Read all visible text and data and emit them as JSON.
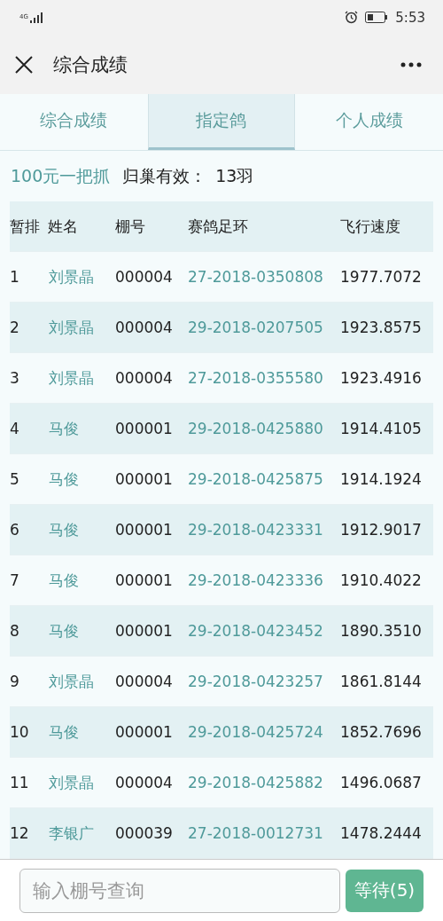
{
  "status_bar": {
    "network": "4G",
    "time": "5:53"
  },
  "header": {
    "title": "综合成绩"
  },
  "tabs": [
    {
      "label": "综合成绩",
      "selected": false
    },
    {
      "label": "指定鸽",
      "selected": true
    },
    {
      "label": "个人成绩",
      "selected": false
    }
  ],
  "summary": {
    "race": "100元一把抓",
    "label": "归巢有效：",
    "count": "13羽"
  },
  "table": {
    "columns": [
      "暂排",
      "姓名",
      "棚号",
      "赛鸽足环",
      "飞行速度"
    ],
    "rows": [
      [
        "1",
        "刘景晶",
        "000004",
        "27-2018-0350808",
        "1977.7072"
      ],
      [
        "2",
        "刘景晶",
        "000004",
        "29-2018-0207505",
        "1923.8575"
      ],
      [
        "3",
        "刘景晶",
        "000004",
        "27-2018-0355580",
        "1923.4916"
      ],
      [
        "4",
        "马俊",
        "000001",
        "29-2018-0425880",
        "1914.4105"
      ],
      [
        "5",
        "马俊",
        "000001",
        "29-2018-0425875",
        "1914.1924"
      ],
      [
        "6",
        "马俊",
        "000001",
        "29-2018-0423331",
        "1912.9017"
      ],
      [
        "7",
        "马俊",
        "000001",
        "29-2018-0423336",
        "1910.4022"
      ],
      [
        "8",
        "马俊",
        "000001",
        "29-2018-0423452",
        "1890.3510"
      ],
      [
        "9",
        "刘景晶",
        "000004",
        "29-2018-0423257",
        "1861.8144"
      ],
      [
        "10",
        "马俊",
        "000001",
        "29-2018-0425724",
        "1852.7696"
      ],
      [
        "11",
        "刘景晶",
        "000004",
        "29-2018-0425882",
        "1496.0687"
      ],
      [
        "12",
        "李银广",
        "000039",
        "27-2018-0012731",
        "1478.2444"
      ]
    ]
  },
  "search": {
    "placeholder": "输入棚号查询",
    "button": "等待(5)"
  }
}
